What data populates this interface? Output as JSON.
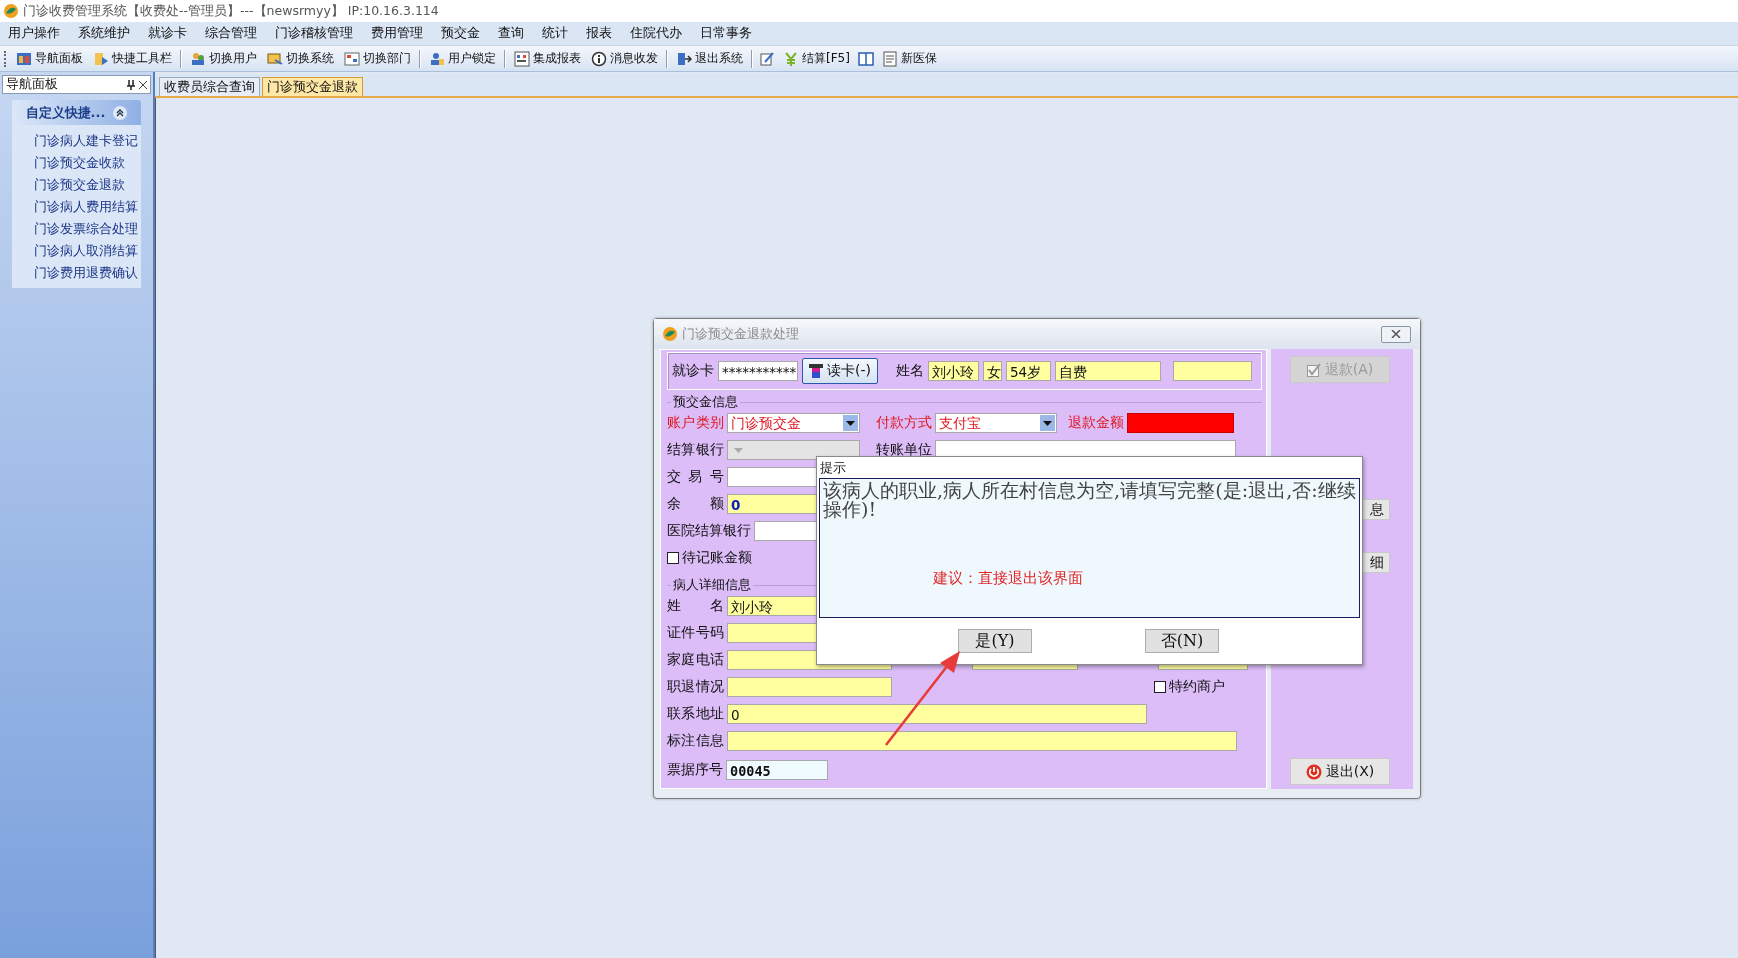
{
  "window": {
    "title": "门诊收费管理系统【收费处--管理员】---【newsrmyy】 IP:10.16.3.114"
  },
  "menu": [
    "用户操作",
    "系统维护",
    "就诊卡",
    "综合管理",
    "门诊稽核管理",
    "费用管理",
    "预交金",
    "查询",
    "统计",
    "报表",
    "住院代办",
    "日常事务"
  ],
  "toolbar": [
    {
      "kind": "button",
      "label": "导航面板"
    },
    {
      "kind": "button",
      "label": "快捷工具栏"
    },
    {
      "kind": "separator"
    },
    {
      "kind": "button",
      "label": "切换用户"
    },
    {
      "kind": "button",
      "label": "切换系统"
    },
    {
      "kind": "button",
      "label": "切换部门"
    },
    {
      "kind": "separator"
    },
    {
      "kind": "button",
      "label": "用户锁定"
    },
    {
      "kind": "separator"
    },
    {
      "kind": "button",
      "label": "集成报表"
    },
    {
      "kind": "button",
      "label": "消息收发"
    },
    {
      "kind": "separator"
    },
    {
      "kind": "button",
      "label": "退出系统"
    },
    {
      "kind": "separator"
    },
    {
      "kind": "icon"
    },
    {
      "kind": "button",
      "label": "结算[F5]"
    },
    {
      "kind": "icon"
    },
    {
      "kind": "button",
      "label": "新医保"
    }
  ],
  "nav_panel": {
    "title": "导航面板",
    "group": {
      "title": "自定义快捷...",
      "expanded": true,
      "items": [
        "门诊病人建卡登记",
        "门诊预交金收款",
        "门诊预交金退款",
        "门诊病人费用结算",
        "门诊发票综合处理",
        "门诊病人取消结算",
        "门诊费用退费确认"
      ]
    }
  },
  "tabs": [
    {
      "label": "收费员综合查询",
      "selected": false
    },
    {
      "label": "门诊预交金退款",
      "selected": true
    }
  ],
  "dialog": {
    "title": "门诊预交金退款处理",
    "card": {
      "label": "就诊卡",
      "value": "***********",
      "read_button": "读卡(-)",
      "name_label": "姓名",
      "name": "刘小玲",
      "sex": "女",
      "age": "54岁",
      "fee_type": "自费"
    },
    "deposit_info": {
      "title": "预交金信息",
      "account_type": {
        "label": "账户类别",
        "value": "门诊预交金"
      },
      "payment_method": {
        "label": "付款方式",
        "value": "支付宝"
      },
      "refund_amount": {
        "label": "退款金额"
      },
      "bank": {
        "label": "结算银行",
        "disabled": true
      },
      "transfer_unit": {
        "label": "转账单位"
      },
      "transaction_no": {
        "label": "交 易 号"
      },
      "balance": {
        "label": "余　额",
        "value": "0"
      },
      "hospital_bank": {
        "label": "医院结算银行"
      },
      "pending": {
        "label": "待记账金额",
        "checked": false
      }
    },
    "patient_info": {
      "title": "病人详细信息",
      "name": {
        "label": "姓　名",
        "value": "刘小玲"
      },
      "id_no": {
        "label": "证件号码"
      },
      "phone": {
        "label": "家庭电话"
      },
      "retire": {
        "label": "职退情况"
      },
      "special": {
        "label": "特约商户",
        "checked": false
      },
      "address": {
        "label": "联系地址",
        "value": "0"
      },
      "remark": {
        "label": "标注信息"
      }
    },
    "receipt_no": {
      "label": "票据序号",
      "value": "00045"
    },
    "side_buttons": [
      {
        "kind": "refund",
        "label": "退款(A)",
        "disabled": true
      },
      {
        "kind": "partial",
        "label": "息",
        "disabled": false
      },
      {
        "kind": "partial",
        "label": "细",
        "disabled": false
      },
      {
        "kind": "exit",
        "label": "退出(X)",
        "disabled": false
      }
    ]
  },
  "prompt": {
    "title": "提示",
    "message": "该病人的职业,病人所在村信息为空,请填写完整(是:退出,否:继续操作)!",
    "suggestion": "建议：直接退出该界面",
    "buttons": [
      "是(Y)",
      "否(N)"
    ]
  }
}
